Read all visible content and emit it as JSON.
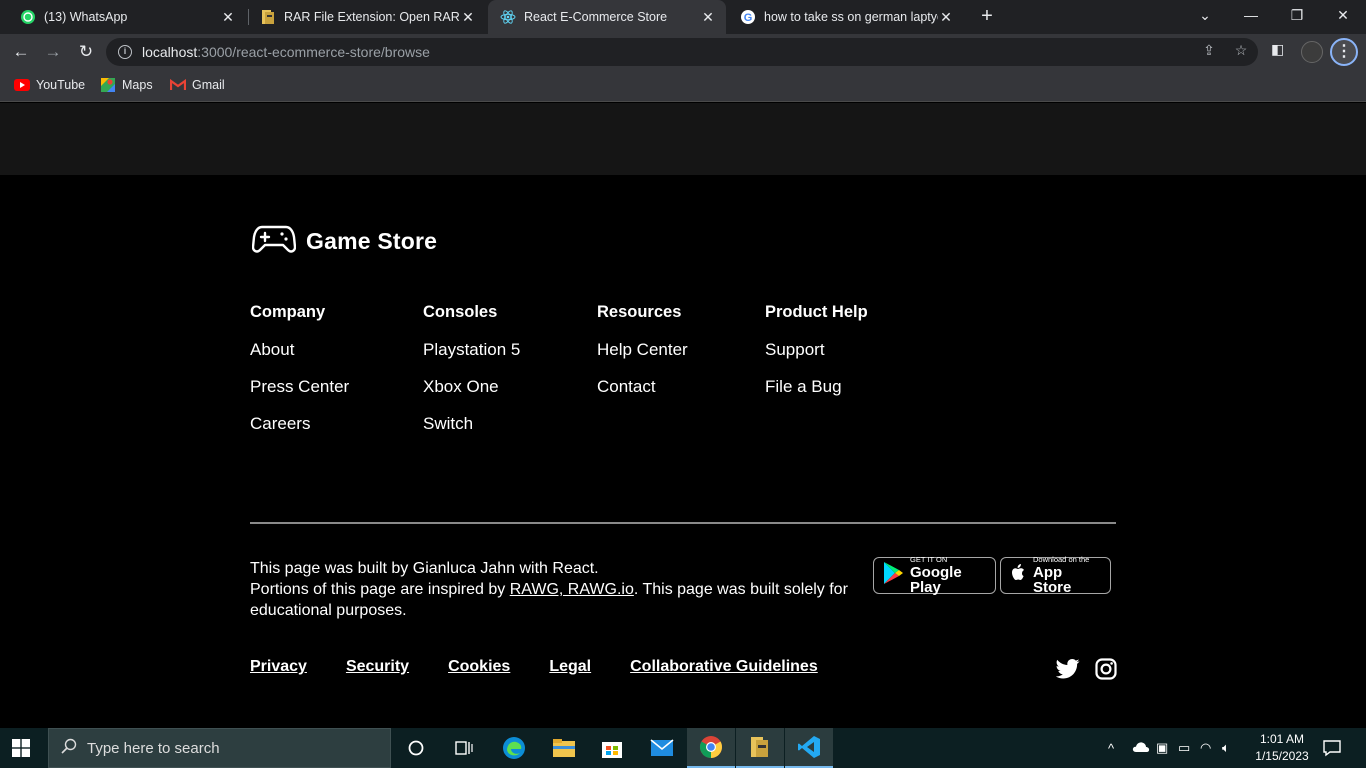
{
  "browser": {
    "tabs": [
      {
        "title": "(13) WhatsApp",
        "icon": "whatsapp-icon"
      },
      {
        "title": "RAR File Extension: Open RAR Fil",
        "icon": "rar-icon"
      },
      {
        "title": "React E-Commerce Store",
        "icon": "react-icon",
        "active": true
      },
      {
        "title": "how to take ss on german laptyo",
        "icon": "google-icon"
      }
    ],
    "url_host": "localhost",
    "url_rest": ":3000/react-ecommerce-store/browse",
    "bookmarks": [
      {
        "label": "YouTube",
        "icon": "youtube-icon"
      },
      {
        "label": "Maps",
        "icon": "maps-icon"
      },
      {
        "label": "Gmail",
        "icon": "gmail-icon"
      }
    ]
  },
  "footer": {
    "brand": "Game Store",
    "columns": [
      {
        "heading": "Company",
        "links": [
          "About",
          "Press Center",
          "Careers"
        ]
      },
      {
        "heading": "Consoles",
        "links": [
          "Playstation 5",
          "Xbox One",
          "Switch"
        ]
      },
      {
        "heading": "Resources",
        "links": [
          "Help Center",
          "Contact"
        ]
      },
      {
        "heading": "Product Help",
        "links": [
          "Support",
          "File a Bug"
        ]
      }
    ],
    "credits_line1": "This page was built by Gianluca Jahn with React.",
    "credits_prefix": "Portions of this page are inspired by ",
    "credits_link": "RAWG, RAWG.io",
    "credits_suffix": ". This page was built solely for educational purposes.",
    "google_play_small": "GET IT ON",
    "google_play_big": "Google Play",
    "app_store_small": "Download on the",
    "app_store_big": "App Store",
    "legal_links": [
      "Privacy",
      "Security",
      "Cookies",
      "Legal",
      "Collaborative Guidelines"
    ]
  },
  "taskbar": {
    "search_placeholder": "Type here to search",
    "time": "1:01 AM",
    "date": "1/15/2023"
  }
}
